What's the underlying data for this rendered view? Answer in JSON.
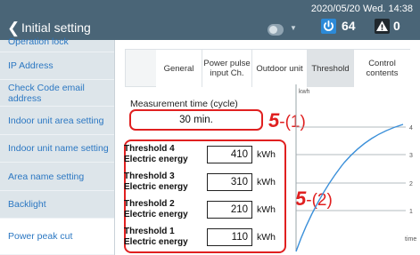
{
  "header": {
    "date": "2020/05/20 Wed. 14:38",
    "title": "Initial setting",
    "power_count": "64",
    "warning_count": "0"
  },
  "sidebar": {
    "items": [
      {
        "label": "Operation lock"
      },
      {
        "label": "IP Address"
      },
      {
        "label": "Check Code email address"
      },
      {
        "label": "Indoor unit area setting"
      },
      {
        "label": "Indoor unit name setting"
      },
      {
        "label": "Area name setting"
      },
      {
        "label": "Backlight"
      },
      {
        "label": "Power peak cut"
      }
    ],
    "active_index": 7
  },
  "tabs": [
    {
      "label": "General"
    },
    {
      "label": "Power pulse input Ch."
    },
    {
      "label": "Outdoor unit"
    },
    {
      "label": "Threshold"
    },
    {
      "label": "Control contents"
    }
  ],
  "selected_tab": "Threshold",
  "measurement": {
    "label": "Measurement time (cycle)",
    "value": "30 min."
  },
  "thresholds": [
    {
      "name": "Threshold 4 Electric energy",
      "value": "410",
      "unit": "kWh"
    },
    {
      "name": "Threshold 3 Electric energy",
      "value": "310",
      "unit": "kWh"
    },
    {
      "name": "Threshold 2 Electric energy",
      "value": "210",
      "unit": "kWh"
    },
    {
      "name": "Threshold 1 Electric energy",
      "value": "110",
      "unit": "kWh"
    }
  ],
  "callouts": {
    "one": {
      "number": "5",
      "suffix": "-(1)"
    },
    "two": {
      "number": "5",
      "suffix": "-(2)"
    }
  },
  "graph": {
    "y_unit": "kwh",
    "x_unit": "time",
    "levels": [
      "4",
      "3",
      "2",
      "1"
    ]
  },
  "colors": {
    "header": "#4a6577",
    "sidebar": "#dde5ea",
    "link": "#2b77c2",
    "highlight": "#e02020",
    "curve": "#3a8fd9",
    "power_badge": "#2c8ad8"
  }
}
